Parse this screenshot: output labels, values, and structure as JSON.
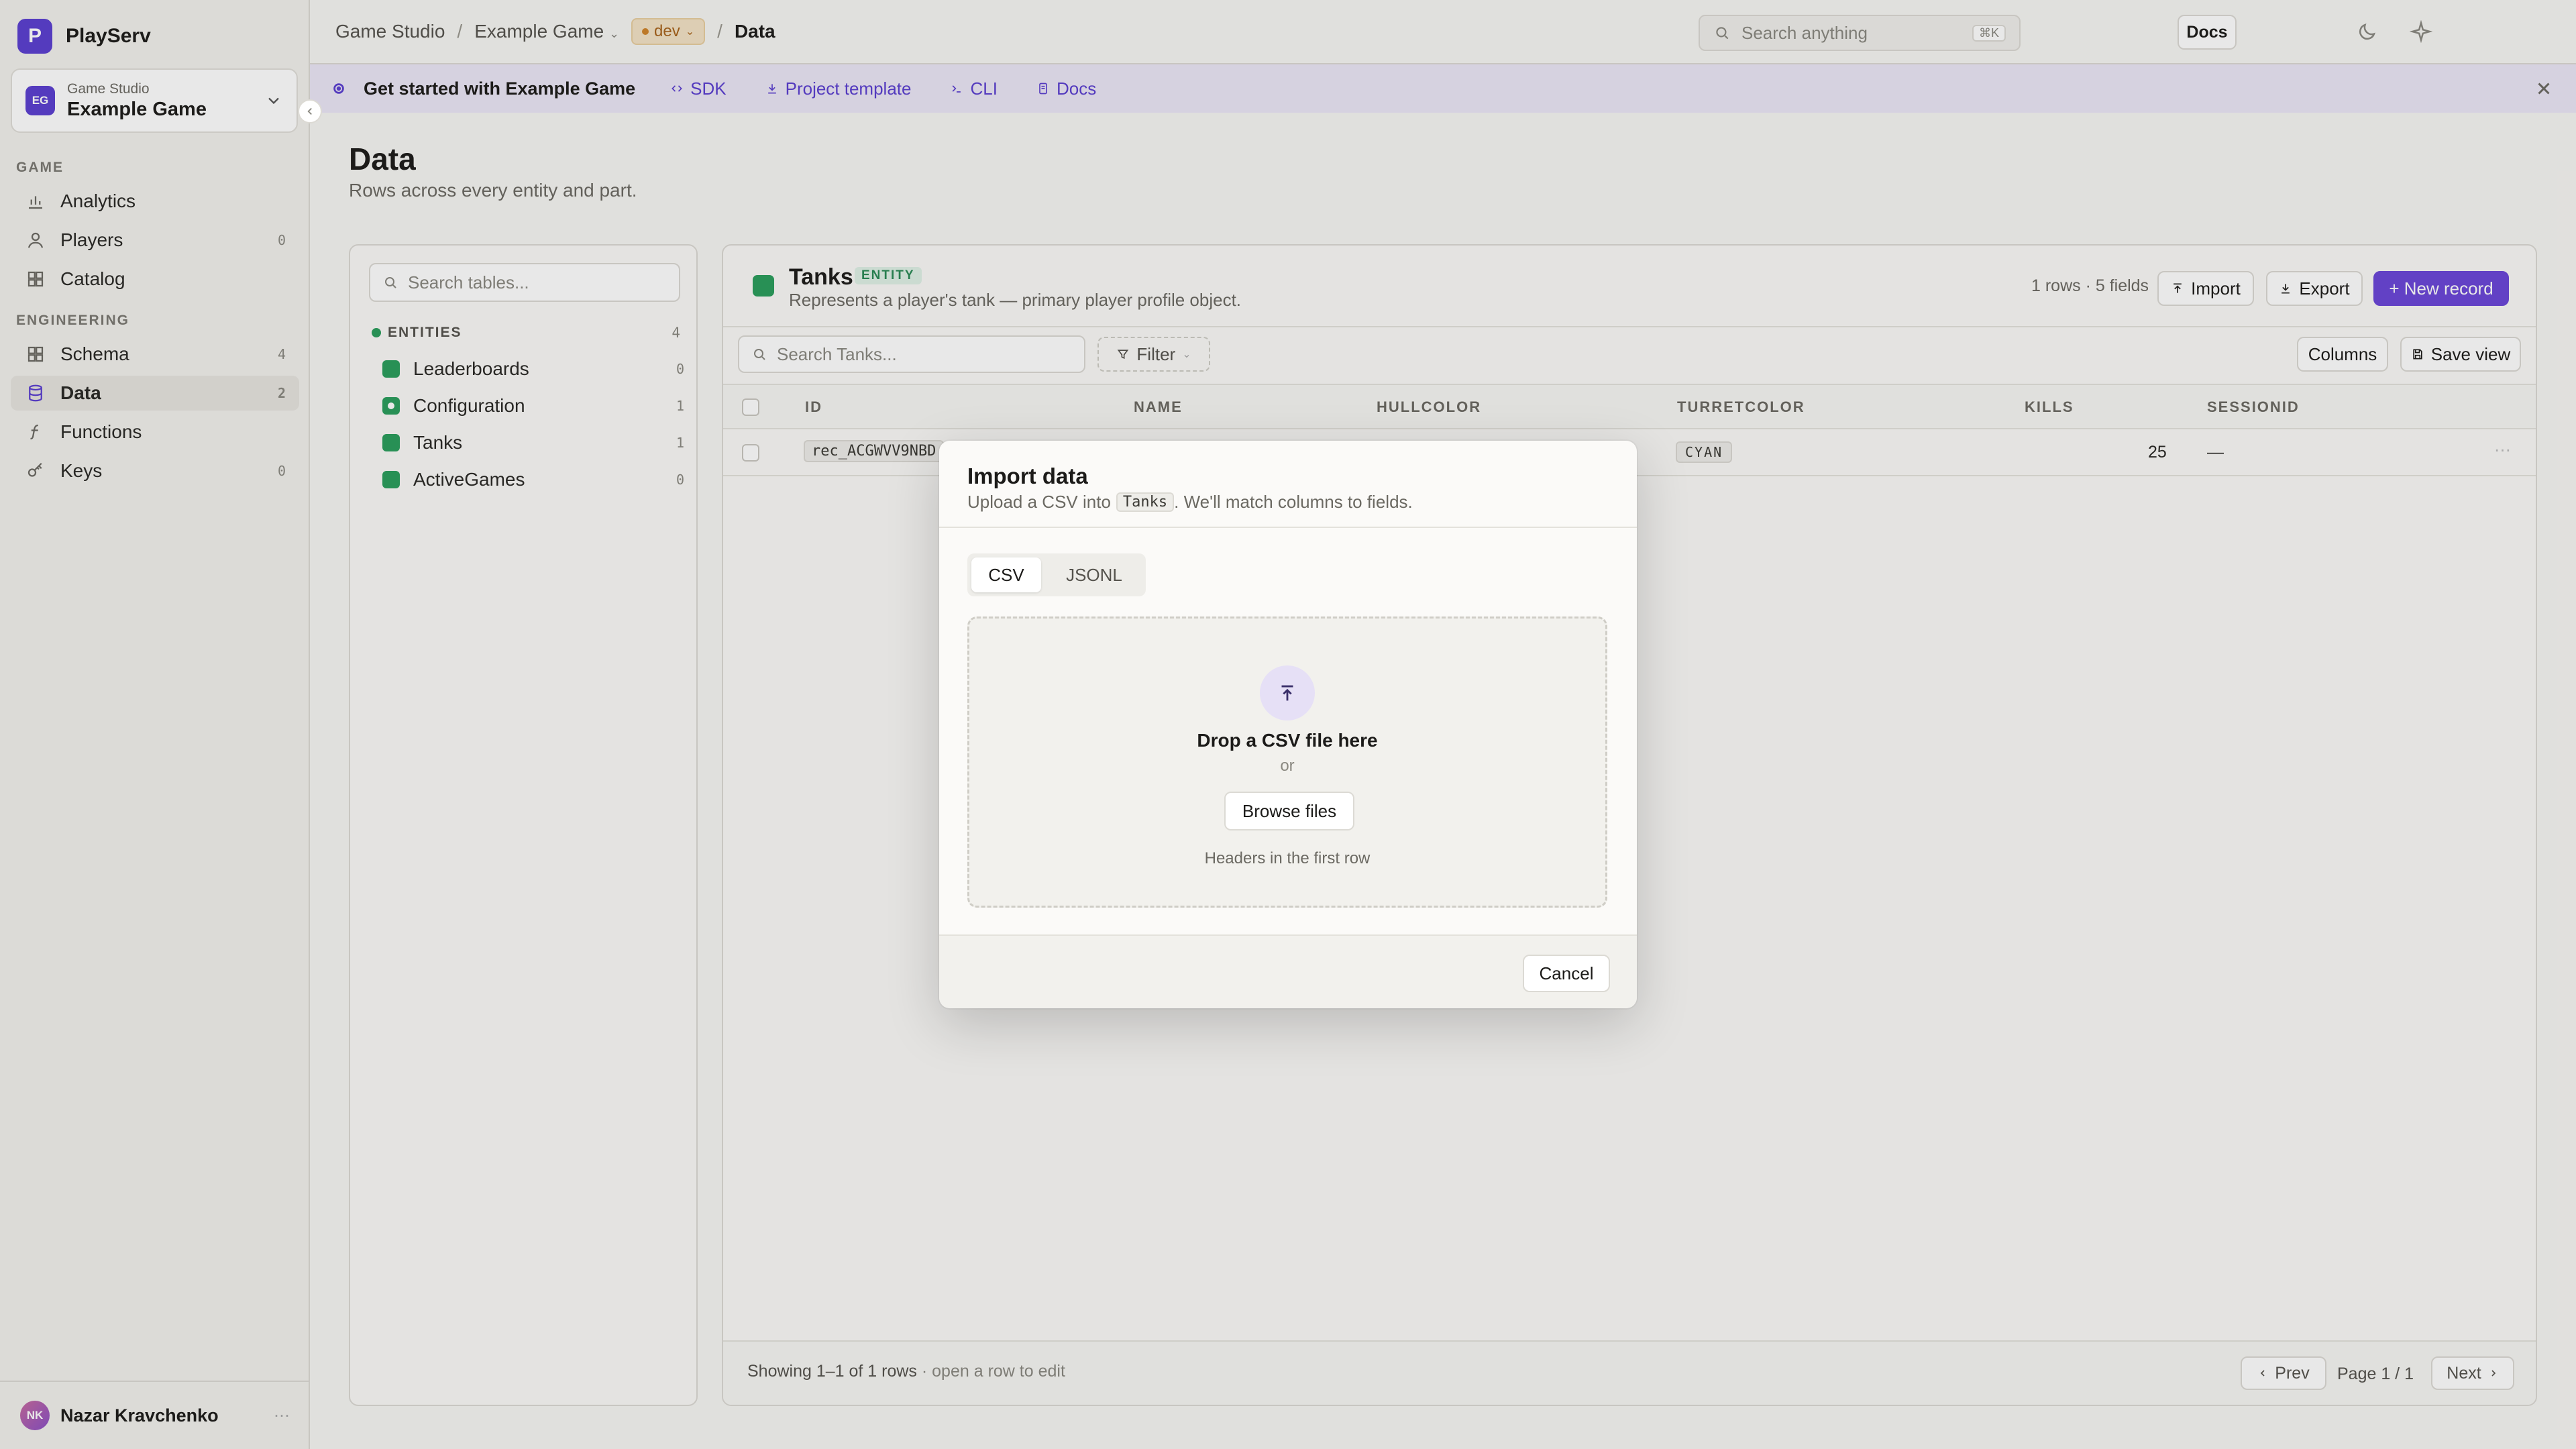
{
  "app": {
    "name": "PlayServ",
    "logo_letter": "P",
    "brand_color": "#5b3fd1"
  },
  "project": {
    "org": "Game Studio",
    "name": "Example Game",
    "initials": "EG"
  },
  "sidebar": {
    "sections": [
      {
        "title": "GAME",
        "items": [
          {
            "label": "Analytics",
            "icon": "bar-chart-icon",
            "count": ""
          },
          {
            "label": "Players",
            "icon": "user-icon",
            "count": "0"
          },
          {
            "label": "Catalog",
            "icon": "grid-icon",
            "count": ""
          }
        ]
      },
      {
        "title": "ENGINEERING",
        "items": [
          {
            "label": "Schema",
            "icon": "grid-icon",
            "count": "4"
          },
          {
            "label": "Data",
            "icon": "database-icon",
            "count": "2",
            "active": true
          },
          {
            "label": "Functions",
            "icon": "function-icon",
            "count": ""
          },
          {
            "label": "Keys",
            "icon": "key-icon",
            "count": "0"
          }
        ]
      }
    ],
    "user": {
      "name": "Nazar Kravchenko",
      "initials": "NK"
    }
  },
  "topbar": {
    "breadcrumbs": [
      "Game Studio",
      "Example Game",
      "Data"
    ],
    "env": "dev",
    "search_placeholder": "Search anything",
    "search_shortcut": "⌘K",
    "docs_label": "Docs"
  },
  "banner": {
    "title": "Get started with Example Game",
    "links": [
      {
        "label": "SDK",
        "icon": "code-icon"
      },
      {
        "label": "Project template",
        "icon": "download-icon"
      },
      {
        "label": "CLI",
        "icon": "terminal-icon"
      },
      {
        "label": "Docs",
        "icon": "doc-icon"
      }
    ]
  },
  "page": {
    "title": "Data",
    "subtitle": "Rows across every entity and part."
  },
  "tables_panel": {
    "search_placeholder": "Search tables...",
    "group": {
      "label": "ENTITIES",
      "count": "4",
      "color": "#2a9d5c"
    },
    "tables": [
      {
        "name": "Leaderboards",
        "count": "0"
      },
      {
        "name": "Configuration",
        "count": "1"
      },
      {
        "name": "Tanks",
        "count": "1",
        "active": true
      },
      {
        "name": "ActiveGames",
        "count": "0"
      }
    ]
  },
  "entity": {
    "name": "Tanks",
    "badge": "ENTITY",
    "description": "Represents a player's tank — primary player profile object.",
    "stats": "1 rows · 5 fields",
    "import_label": "Import",
    "export_label": "Export",
    "new_record_label": "+ New record",
    "search_placeholder": "Search Tanks...",
    "filter_label": "Filter",
    "columns_label": "Columns",
    "save_view_label": "Save view",
    "columns": [
      "ID",
      "NAME",
      "HULLCOLOR",
      "TURRETCOLOR",
      "KILLS",
      "SESSIONID"
    ],
    "rows": [
      {
        "id": "rec_ACGWVV9NBD",
        "name": "",
        "hullcolor": "",
        "turretcolor": "CYAN",
        "kills": "25",
        "sessionid": "—"
      }
    ],
    "footer_showing": "Showing 1–1 of 1 rows",
    "footer_hint": " · open a row to edit",
    "prev_label": "Prev",
    "page_label": "Page 1 / 1",
    "next_label": "Next"
  },
  "modal": {
    "title": "Import data",
    "subtitle_before": "Upload a CSV into",
    "subtitle_table": "Tanks",
    "subtitle_after": ". We'll match columns to fields.",
    "tabs": [
      "CSV",
      "JSONL"
    ],
    "active_tab": "CSV",
    "drop_title": "Drop a CSV file here",
    "drop_or": "or",
    "browse_label": "Browse files",
    "drop_hint": "Headers in the first row",
    "cancel_label": "Cancel"
  }
}
